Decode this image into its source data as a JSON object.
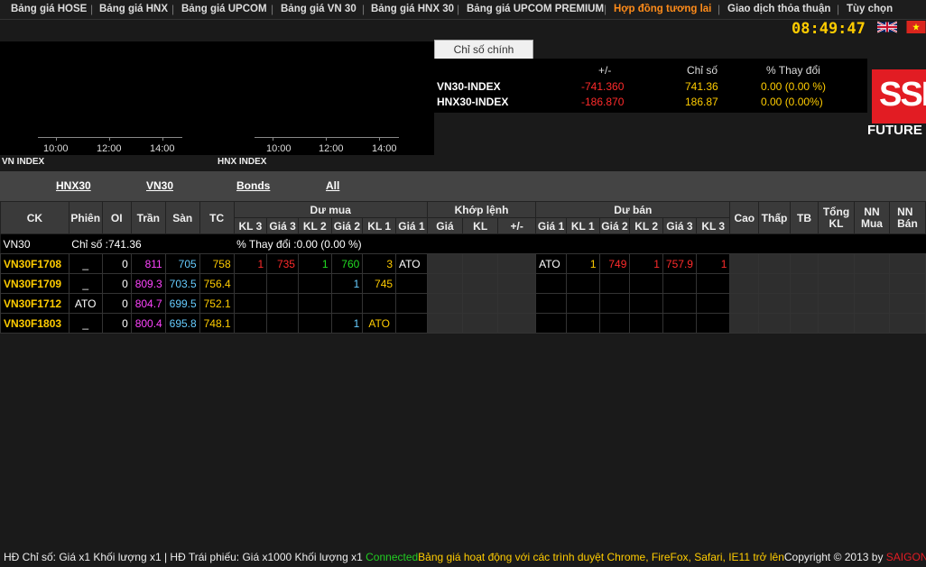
{
  "nav": {
    "items": [
      "Bảng giá HOSE",
      "Bảng giá HNX",
      "Bảng giá UPCOM",
      "Bảng giá VN 30",
      "Bảng giá HNX 30",
      "Bảng giá UPCOM PREMIUM",
      "Hợp đồng tương lai",
      "Giao dịch thỏa thuận",
      "Tùy chọn"
    ],
    "active": "Hợp đồng tương lai"
  },
  "clock": "08:49:47",
  "flags": [
    "uk-flag",
    "vietnam-flag"
  ],
  "mini_charts": [
    {
      "label": "VN INDEX",
      "ticks": [
        "10:00",
        "12:00",
        "14:00"
      ]
    },
    {
      "label": "HNX INDEX",
      "ticks": [
        "10:00",
        "12:00",
        "14:00"
      ]
    }
  ],
  "index_panel": {
    "tab": "Chỉ số chính",
    "headers": {
      "change": "+/-",
      "index": "Chỉ số",
      "pct": "% Thay đổi"
    },
    "rows": [
      {
        "name": "VN30-INDEX",
        "change": "-741.360",
        "index": "741.36",
        "pct": "0.00 (0.00 %)"
      },
      {
        "name": "HNX30-INDEX",
        "change": "-186.870",
        "index": "186.87",
        "pct": "0.00 (0.00%)"
      }
    ]
  },
  "logo": {
    "text": "SSI",
    "sub": "FUTURE"
  },
  "filters": [
    "HNX30",
    "VN30",
    "Bonds",
    "All"
  ],
  "table": {
    "h1": {
      "ck": "CK",
      "phien": "Phiên",
      "oi": "OI",
      "tran": "Trần",
      "san": "Sàn",
      "tc": "TC",
      "du_mua": "Dư mua",
      "khop_lenh": "Khớp lệnh",
      "du_ban": "Dư bán",
      "cao": "Cao",
      "thap": "Thấp",
      "tb": "TB",
      "tong_kl": "Tổng KL",
      "nn_mua": "NN Mua",
      "nn_ban": "NN Bán"
    },
    "h2": {
      "kl3": "KL 3",
      "gia3": "Giá 3",
      "kl2": "KL 2",
      "gia2": "Giá 2",
      "kl1": "KL 1",
      "gia1": "Giá 1",
      "gia": "Giá",
      "kl": "KL",
      "chg": "+/-",
      "s_gia1": "Giá 1",
      "s_kl1": "KL 1",
      "s_gia2": "Giá 2",
      "s_kl2": "KL 2",
      "s_gia3": "Giá 3",
      "s_kl3": "KL 3"
    },
    "index_row": {
      "name": "VN30",
      "index_text": "Chỉ số :741.36",
      "pct_text": "% Thay đổi :0.00 (0.00 %)"
    },
    "rows": [
      {
        "ck": "VN30F1708",
        "phien": "_",
        "oi": "0",
        "tran": "811",
        "san": "705",
        "tc": "758",
        "b_kl3": "1",
        "b_gia3": "735",
        "b_kl2": "1",
        "b_gia2": "760",
        "b_kl1": "3",
        "b_gia1": "ATO",
        "s_gia1": "ATO",
        "s_kl1": "1",
        "s_gia2": "749",
        "s_kl2": "1",
        "s_gia3": "757.9",
        "s_kl3": "1"
      },
      {
        "ck": "VN30F1709",
        "phien": "_",
        "oi": "0",
        "tran": "809.3",
        "san": "703.5",
        "tc": "756.4",
        "b_kl3": "",
        "b_gia3": "",
        "b_kl2": "",
        "b_gia2": "1",
        "b_kl1": "745",
        "b_gia1": "",
        "s_gia1": "",
        "s_kl1": "",
        "s_gia2": "",
        "s_kl2": "",
        "s_gia3": "",
        "s_kl3": ""
      },
      {
        "ck": "VN30F1712",
        "phien": "ATO",
        "oi": "0",
        "tran": "804.7",
        "san": "699.5",
        "tc": "752.1",
        "b_kl3": "",
        "b_gia3": "",
        "b_kl2": "",
        "b_gia2": "",
        "b_kl1": "",
        "b_gia1": "",
        "s_gia1": "",
        "s_kl1": "",
        "s_gia2": "",
        "s_kl2": "",
        "s_gia3": "",
        "s_kl3": ""
      },
      {
        "ck": "VN30F1803",
        "phien": "_",
        "oi": "0",
        "tran": "800.4",
        "san": "695.8",
        "tc": "748.1",
        "b_kl3": "",
        "b_gia3": "",
        "b_kl2": "",
        "b_gia2": "1",
        "b_kl1": "ATO",
        "b_gia1": "",
        "s_gia1": "",
        "s_kl1": "",
        "s_gia2": "",
        "s_kl2": "",
        "s_gia3": "",
        "s_kl3": ""
      }
    ]
  },
  "footer": {
    "info": "HĐ Chỉ số: Giá x1 Khối lượng x1 | HĐ Trái phiếu: Giá x1000 Khối lượng x1",
    "status": "Connected",
    "browsers": "Bảng giá hoạt động với các trình duyệt Chrome, FireFox, Safari, IE11 trở lên",
    "copyright": "Copyright © 2013 by ",
    "brand": "SAIGON"
  },
  "colors": {
    "accent": "#ff8c1a",
    "clock": "#ffcc00",
    "ceiling": "#ff44ff",
    "floor": "#66ccff",
    "reference": "#ffcc00",
    "down": "#ff2b2b",
    "up": "#22dd22",
    "connected": "#22cc22",
    "brand": "#e21c23"
  }
}
